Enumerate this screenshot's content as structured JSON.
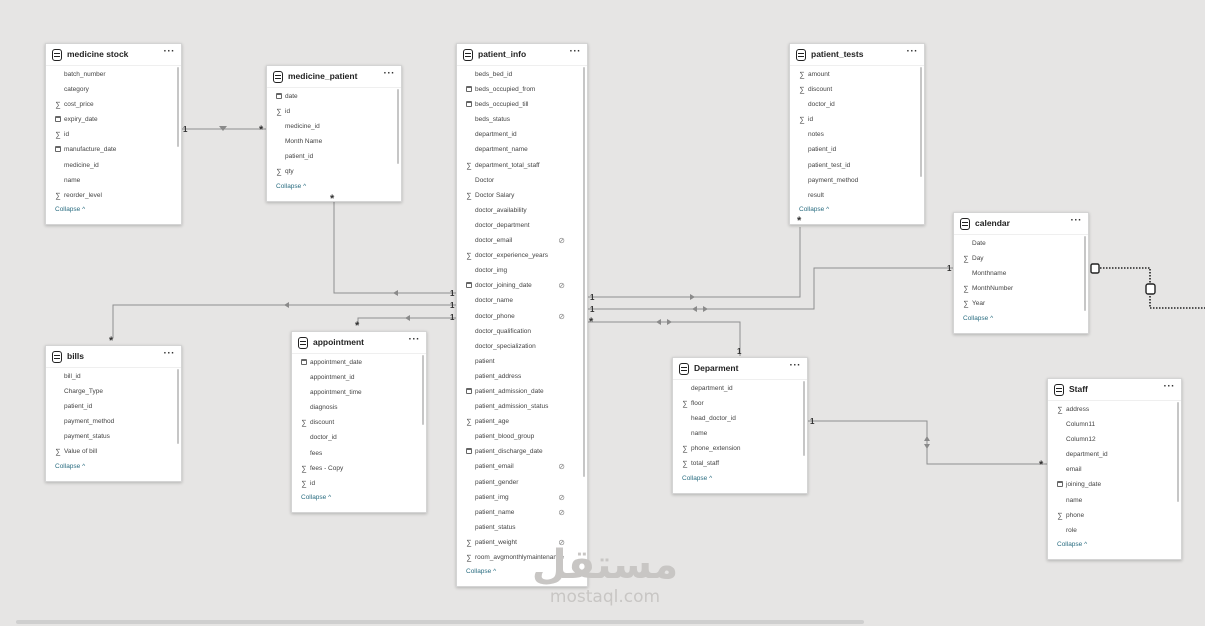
{
  "tables": [
    {
      "id": "medicine_stock",
      "title": "medicine stock",
      "collapse": "Collapse ^",
      "fields": [
        {
          "icon": "",
          "name": "batch_number"
        },
        {
          "icon": "sigma",
          "name": "category",
          "noicon": true
        },
        {
          "icon": "sigma",
          "name": "cost_price"
        },
        {
          "icon": "calendar",
          "name": "expiry_date"
        },
        {
          "icon": "sigma",
          "name": "id"
        },
        {
          "icon": "calendar",
          "name": "manufacture_date"
        },
        {
          "icon": "",
          "name": "medicine_id"
        },
        {
          "icon": "",
          "name": "name"
        },
        {
          "icon": "sigma",
          "name": "reorder_level"
        }
      ]
    },
    {
      "id": "medicine_patient",
      "title": "medicine_patient",
      "collapse": "Collapse ^",
      "fields": [
        {
          "icon": "calendar",
          "name": "date"
        },
        {
          "icon": "sigma",
          "name": "id"
        },
        {
          "icon": "",
          "name": "medicine_id"
        },
        {
          "icon": "",
          "name": "Month Name"
        },
        {
          "icon": "",
          "name": "patient_id"
        },
        {
          "icon": "sigma",
          "name": "qty"
        }
      ]
    },
    {
      "id": "patient_info",
      "title": "patient_info",
      "collapse": "Collapse ^",
      "fields": [
        {
          "icon": "",
          "name": "beds_bed_id"
        },
        {
          "icon": "calendar",
          "name": "beds_occupied_from"
        },
        {
          "icon": "calendar",
          "name": "beds_occupied_till"
        },
        {
          "icon": "",
          "name": "beds_status"
        },
        {
          "icon": "",
          "name": "department_id"
        },
        {
          "icon": "",
          "name": "department_name"
        },
        {
          "icon": "sigma",
          "name": "department_total_staff"
        },
        {
          "icon": "",
          "name": "Doctor"
        },
        {
          "icon": "sigma",
          "name": "Doctor Salary"
        },
        {
          "icon": "",
          "name": "doctor_availability"
        },
        {
          "icon": "",
          "name": "doctor_department"
        },
        {
          "icon": "",
          "name": "doctor_email",
          "hidden": true
        },
        {
          "icon": "sigma",
          "name": "doctor_experience_years"
        },
        {
          "icon": "",
          "name": "doctor_img"
        },
        {
          "icon": "calendar",
          "name": "doctor_joining_date",
          "hidden": true
        },
        {
          "icon": "",
          "name": "doctor_name"
        },
        {
          "icon": "",
          "name": "doctor_phone",
          "hidden": true
        },
        {
          "icon": "",
          "name": "doctor_qualification"
        },
        {
          "icon": "",
          "name": "doctor_specialization"
        },
        {
          "icon": "",
          "name": "patient"
        },
        {
          "icon": "",
          "name": "patient_address"
        },
        {
          "icon": "calendar",
          "name": "patient_admission_date"
        },
        {
          "icon": "",
          "name": "patient_admission_status"
        },
        {
          "icon": "sigma",
          "name": "patient_age"
        },
        {
          "icon": "",
          "name": "patient_blood_group"
        },
        {
          "icon": "calendar",
          "name": "patient_discharge_date"
        },
        {
          "icon": "",
          "name": "patient_email",
          "hidden": true
        },
        {
          "icon": "",
          "name": "patient_gender"
        },
        {
          "icon": "",
          "name": "patient_img",
          "hidden": true
        },
        {
          "icon": "",
          "name": "patient_name",
          "hidden": true
        },
        {
          "icon": "",
          "name": "patient_status"
        },
        {
          "icon": "sigma",
          "name": "patient_weight",
          "hidden": true
        },
        {
          "icon": "sigma",
          "name": "room_avgmonthlymaintenance"
        }
      ]
    },
    {
      "id": "patient_tests",
      "title": "patient_tests",
      "collapse": "Collapse ^",
      "fields": [
        {
          "icon": "sigma",
          "name": "amount"
        },
        {
          "icon": "sigma",
          "name": "discount"
        },
        {
          "icon": "",
          "name": "doctor_id"
        },
        {
          "icon": "sigma",
          "name": "id"
        },
        {
          "icon": "",
          "name": "notes"
        },
        {
          "icon": "",
          "name": "patient_id"
        },
        {
          "icon": "",
          "name": "patient_test_id"
        },
        {
          "icon": "",
          "name": "payment_method"
        },
        {
          "icon": "",
          "name": "result"
        }
      ]
    },
    {
      "id": "calendar",
      "title": "calendar",
      "collapse": "Collapse ^",
      "fields": [
        {
          "icon": "",
          "name": "Date"
        },
        {
          "icon": "sigma",
          "name": "Day"
        },
        {
          "icon": "",
          "name": "Monthname"
        },
        {
          "icon": "sigma",
          "name": "MonthNumber"
        },
        {
          "icon": "sigma",
          "name": "Year"
        }
      ]
    },
    {
      "id": "bills",
      "title": "bills",
      "collapse": "Collapse ^",
      "fields": [
        {
          "icon": "",
          "name": "bill_id"
        },
        {
          "icon": "",
          "name": "Charge_Type"
        },
        {
          "icon": "",
          "name": "patient_id"
        },
        {
          "icon": "",
          "name": "payment_method"
        },
        {
          "icon": "",
          "name": "payment_status"
        },
        {
          "icon": "sigma",
          "name": "Value of bill"
        }
      ]
    },
    {
      "id": "appointment",
      "title": "appointment",
      "collapse": "Collapse ^",
      "fields": [
        {
          "icon": "calendar",
          "name": "appointment_date"
        },
        {
          "icon": "",
          "name": "appointment_id"
        },
        {
          "icon": "",
          "name": "appointment_time"
        },
        {
          "icon": "",
          "name": "diagnosis"
        },
        {
          "icon": "sigma",
          "name": "discount"
        },
        {
          "icon": "",
          "name": "doctor_id"
        },
        {
          "icon": "",
          "name": "fees"
        },
        {
          "icon": "sigma",
          "name": "fees - Copy"
        },
        {
          "icon": "sigma",
          "name": "id"
        }
      ]
    },
    {
      "id": "deparment",
      "title": "Deparment",
      "collapse": "Collapse ^",
      "fields": [
        {
          "icon": "",
          "name": "department_id"
        },
        {
          "icon": "sigma",
          "name": "floor"
        },
        {
          "icon": "",
          "name": "head_doctor_id"
        },
        {
          "icon": "",
          "name": "name"
        },
        {
          "icon": "sigma",
          "name": "phone_extension"
        },
        {
          "icon": "sigma",
          "name": "total_staff"
        }
      ]
    },
    {
      "id": "staff",
      "title": "Staff",
      "collapse": "Collapse ^",
      "fields": [
        {
          "icon": "sigma",
          "name": "address"
        },
        {
          "icon": "",
          "name": "Column11"
        },
        {
          "icon": "",
          "name": "Column12"
        },
        {
          "icon": "",
          "name": "department_id"
        },
        {
          "icon": "",
          "name": "email"
        },
        {
          "icon": "calendar",
          "name": "joining_date"
        },
        {
          "icon": "",
          "name": "name"
        },
        {
          "icon": "sigma",
          "name": "phone"
        },
        {
          "icon": "",
          "name": "role"
        }
      ]
    }
  ],
  "markers": {
    "one": "1",
    "many": "*"
  },
  "watermark": {
    "arabic": "مستقل",
    "url": "mostaql.com"
  }
}
